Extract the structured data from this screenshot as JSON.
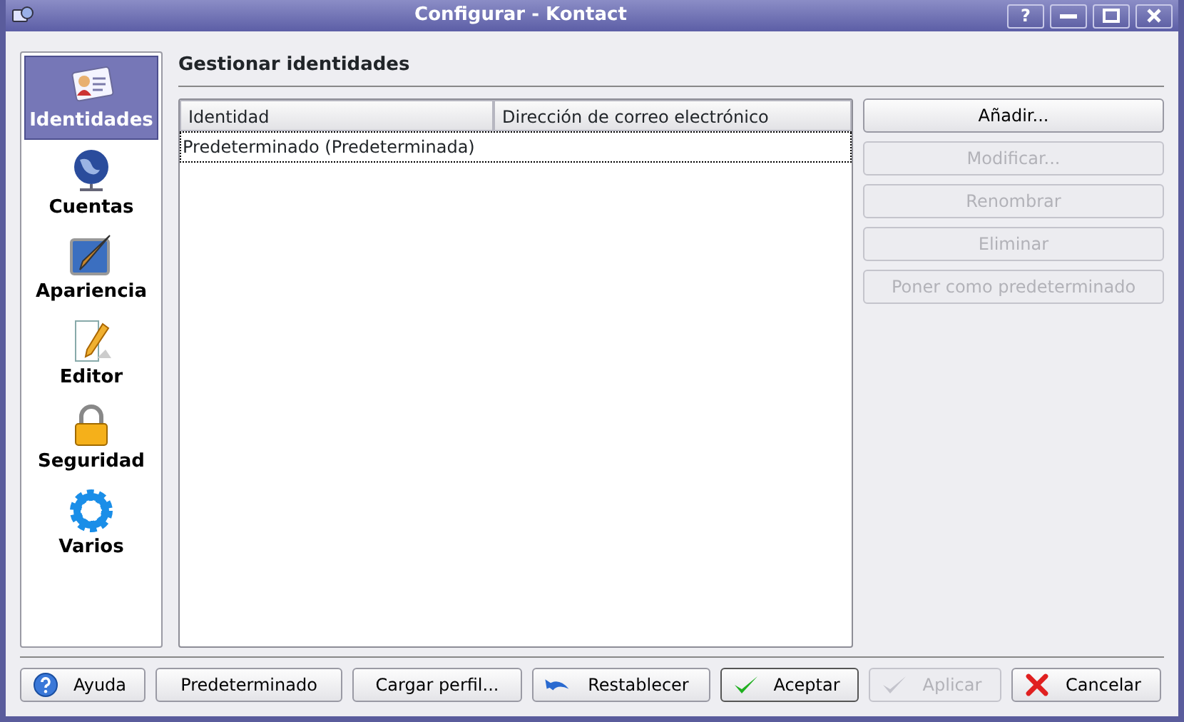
{
  "window": {
    "title": "Configurar - Kontact",
    "help_button": "?"
  },
  "sidebar": {
    "items": [
      {
        "label": "Identidades",
        "selected": true
      },
      {
        "label": "Cuentas",
        "selected": false
      },
      {
        "label": "Apariencia",
        "selected": false
      },
      {
        "label": "Editor",
        "selected": false
      },
      {
        "label": "Seguridad",
        "selected": false
      },
      {
        "label": "Varios",
        "selected": false
      }
    ]
  },
  "page": {
    "title": "Gestionar identidades",
    "table": {
      "columns": [
        "Identidad",
        "Dirección de correo electrónico"
      ],
      "rows": [
        {
          "cells": [
            "Predeterminado (Predeterminada)",
            ""
          ],
          "selected": true
        }
      ]
    },
    "buttons": [
      {
        "label": "Añadir...",
        "disabled": false
      },
      {
        "label": "Modificar...",
        "disabled": true
      },
      {
        "label": "Renombrar",
        "disabled": true
      },
      {
        "label": "Eliminar",
        "disabled": true
      },
      {
        "label": "Poner como predeterminado",
        "disabled": true
      }
    ]
  },
  "footer": {
    "buttons": [
      {
        "label": "Ayuda",
        "disabled": false,
        "default": false
      },
      {
        "label": "Predeterminado",
        "disabled": false,
        "default": false
      },
      {
        "label": "Cargar perfil...",
        "disabled": false,
        "default": false
      },
      {
        "label": "Restablecer",
        "disabled": false,
        "default": false
      },
      {
        "label": "Aceptar",
        "disabled": false,
        "default": true
      },
      {
        "label": "Aplicar",
        "disabled": true,
        "default": false
      },
      {
        "label": "Cancelar",
        "disabled": false,
        "default": false
      }
    ]
  }
}
